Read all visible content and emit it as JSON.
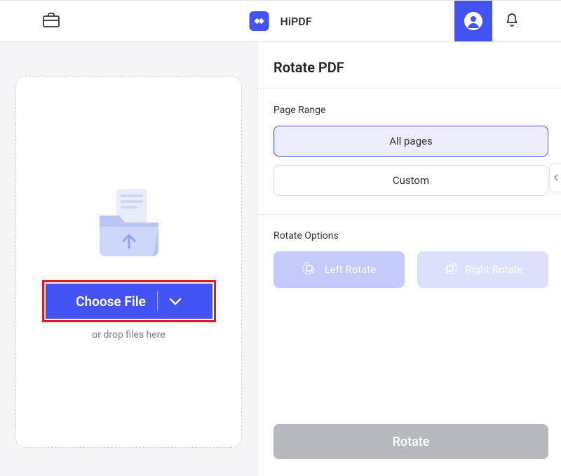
{
  "header": {
    "brand": "HiPDF"
  },
  "left": {
    "choose_label": "Choose File",
    "drop_hint": "or drop files here"
  },
  "right": {
    "title": "Rotate PDF",
    "page_range_label": "Page Range",
    "options": {
      "all": "All pages",
      "custom": "Custom"
    },
    "rotate_options_label": "Rotate Options",
    "rotate": {
      "left": "Left Rotate",
      "right": "Right Rotate"
    },
    "action": "Rotate"
  }
}
